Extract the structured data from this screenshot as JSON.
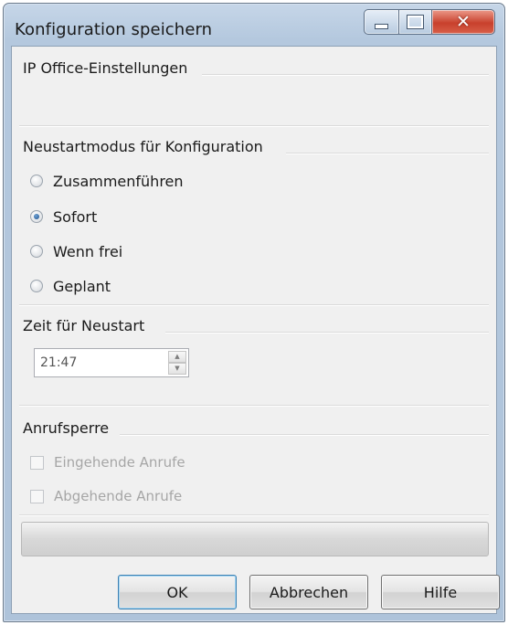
{
  "window": {
    "title": "Konfiguration speichern"
  },
  "groups": {
    "ip_office": {
      "title": "IP Office-Einstellungen"
    },
    "restart_mode": {
      "title": "Neustartmodus für Konfiguration",
      "options": [
        {
          "label": "Zusammenführen",
          "checked": false
        },
        {
          "label": "Sofort",
          "checked": true
        },
        {
          "label": "Wenn frei",
          "checked": false
        },
        {
          "label": "Geplant",
          "checked": false
        }
      ]
    },
    "restart_time": {
      "title": "Zeit für Neustart",
      "value": "21:47"
    },
    "call_barring": {
      "title": "Anrufsperre",
      "options": [
        {
          "label": "Eingehende Anrufe",
          "checked": false,
          "enabled": false
        },
        {
          "label": "Abgehende Anrufe",
          "checked": false,
          "enabled": false
        }
      ]
    }
  },
  "buttons": {
    "ok": "OK",
    "cancel": "Abbrechen",
    "help": "Hilfe"
  },
  "colors": {
    "title_bar": "#b4c8de",
    "close_button": "#c8402c",
    "client_bg": "#f0f0f0",
    "default_button_border": "#3c7fb1",
    "disabled_text": "#a6a6a6"
  }
}
